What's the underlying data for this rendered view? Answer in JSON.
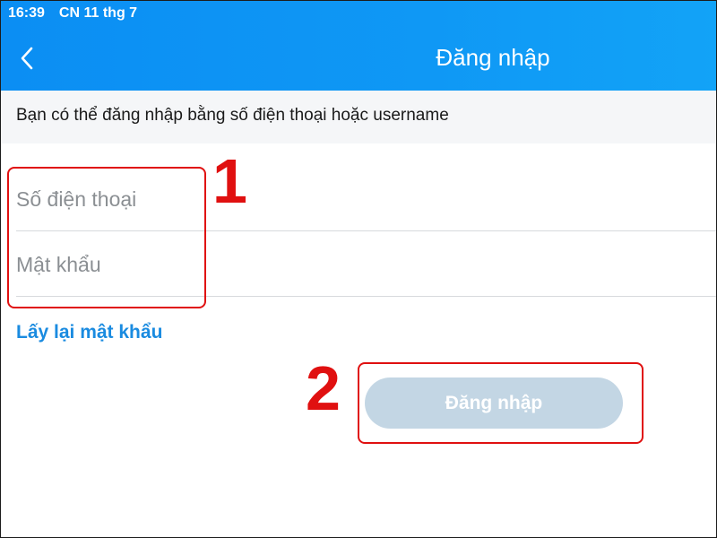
{
  "status_bar": {
    "time": "16:39",
    "date": "CN 11 thg 7"
  },
  "header": {
    "back_icon": "chevron-left-icon",
    "title": "Đăng nhập"
  },
  "info": {
    "text": "Bạn có thể đăng nhập bằng số điện thoại hoặc username"
  },
  "form": {
    "phone_placeholder": "Số điện thoại",
    "phone_value": "",
    "password_placeholder": "Mật khẩu",
    "password_value": "",
    "forgot_label": "Lấy lại mật khẩu",
    "login_label": "Đăng nhập"
  },
  "annotations": {
    "label_1": "1",
    "label_2": "2",
    "color": "#e01010"
  },
  "colors": {
    "accent": "#0f98f5",
    "link": "#1a8be0",
    "button_disabled": "#c3d6e4"
  }
}
